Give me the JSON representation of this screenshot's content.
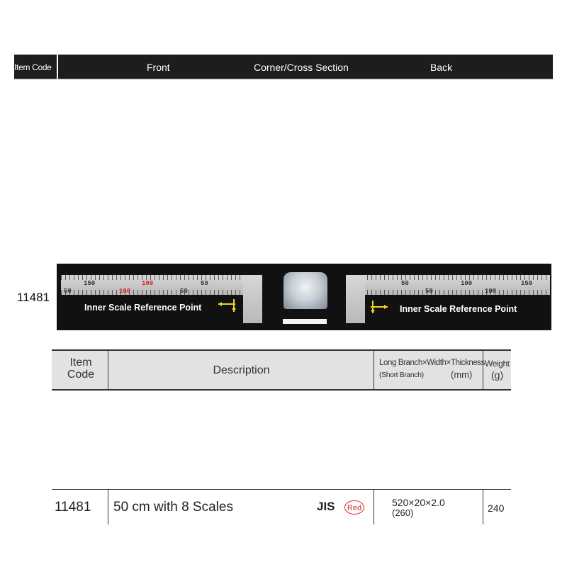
{
  "header": {
    "item_code": "Item Code",
    "front": "Front",
    "corner": "Corner/Cross Section",
    "back": "Back"
  },
  "product_band": {
    "item_code": "11481",
    "front_ruler": {
      "top_numbers": [
        "150",
        "100",
        "50"
      ],
      "bottom_numbers": [
        "50",
        "100",
        "50"
      ],
      "reference_label": "Inner Scale Reference Point"
    },
    "back_ruler": {
      "top_numbers": [
        "50",
        "100",
        "150"
      ],
      "bottom_numbers": [
        "50",
        "100"
      ],
      "reference_label": "Inner Scale Reference Point"
    }
  },
  "spec_table": {
    "headers": {
      "item_code_line1": "Item",
      "item_code_line2": "Code",
      "description": "Description",
      "dim_line1": "Long Branch×Width×Thickness",
      "dim_line2": "(Short Branch)",
      "dim_unit": "(mm)",
      "weight_line1": "Weight",
      "weight_line2": "(g)"
    },
    "rows": [
      {
        "item_code": "11481",
        "description": "50 cm with 8 Scales",
        "standard": "JIS",
        "badge": "Red",
        "dimensions": "520×20×2.0",
        "short_branch": "(260)",
        "weight": "240"
      }
    ]
  },
  "colors": {
    "band_background": "#111111",
    "header_background": "#1d1d1d",
    "table_header_background": "#e2e2e2",
    "accent_red": "#d62828",
    "arrow_yellow": "#f2d21b"
  }
}
